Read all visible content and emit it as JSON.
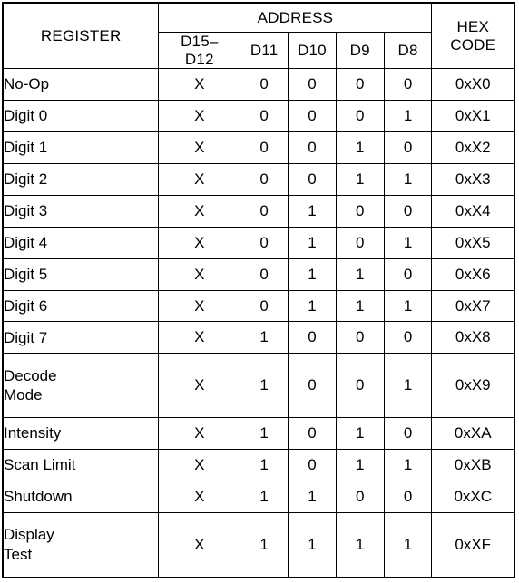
{
  "table": {
    "headers": {
      "register": "REGISTER",
      "address": "ADDRESS",
      "hex_code": "HEX\nCODE",
      "bits": [
        "D15–\nD12",
        "D11",
        "D10",
        "D9",
        "D8"
      ]
    },
    "rows": [
      {
        "register": "No-Op",
        "bits": [
          "X",
          "0",
          "0",
          "0",
          "0"
        ],
        "hex": "0xX0",
        "tall": false
      },
      {
        "register": "Digit 0",
        "bits": [
          "X",
          "0",
          "0",
          "0",
          "1"
        ],
        "hex": "0xX1",
        "tall": false
      },
      {
        "register": "Digit 1",
        "bits": [
          "X",
          "0",
          "0",
          "1",
          "0"
        ],
        "hex": "0xX2",
        "tall": false
      },
      {
        "register": "Digit 2",
        "bits": [
          "X",
          "0",
          "0",
          "1",
          "1"
        ],
        "hex": "0xX3",
        "tall": false
      },
      {
        "register": "Digit 3",
        "bits": [
          "X",
          "0",
          "1",
          "0",
          "0"
        ],
        "hex": "0xX4",
        "tall": false
      },
      {
        "register": "Digit 4",
        "bits": [
          "X",
          "0",
          "1",
          "0",
          "1"
        ],
        "hex": "0xX5",
        "tall": false
      },
      {
        "register": "Digit 5",
        "bits": [
          "X",
          "0",
          "1",
          "1",
          "0"
        ],
        "hex": "0xX6",
        "tall": false
      },
      {
        "register": "Digit 6",
        "bits": [
          "X",
          "0",
          "1",
          "1",
          "1"
        ],
        "hex": "0xX7",
        "tall": false
      },
      {
        "register": "Digit 7",
        "bits": [
          "X",
          "1",
          "0",
          "0",
          "0"
        ],
        "hex": "0xX8",
        "tall": false
      },
      {
        "register": "Decode\nMode",
        "bits": [
          "X",
          "1",
          "0",
          "0",
          "1"
        ],
        "hex": "0xX9",
        "tall": true
      },
      {
        "register": "Intensity",
        "bits": [
          "X",
          "1",
          "0",
          "1",
          "0"
        ],
        "hex": "0xXA",
        "tall": false
      },
      {
        "register": "Scan Limit",
        "bits": [
          "X",
          "1",
          "0",
          "1",
          "1"
        ],
        "hex": "0xXB",
        "tall": false
      },
      {
        "register": "Shutdown",
        "bits": [
          "X",
          "1",
          "1",
          "0",
          "0"
        ],
        "hex": "0xXC",
        "tall": false
      },
      {
        "register": "Display\nTest",
        "bits": [
          "X",
          "1",
          "1",
          "1",
          "1"
        ],
        "hex": "0xXF",
        "tall": true
      }
    ]
  }
}
